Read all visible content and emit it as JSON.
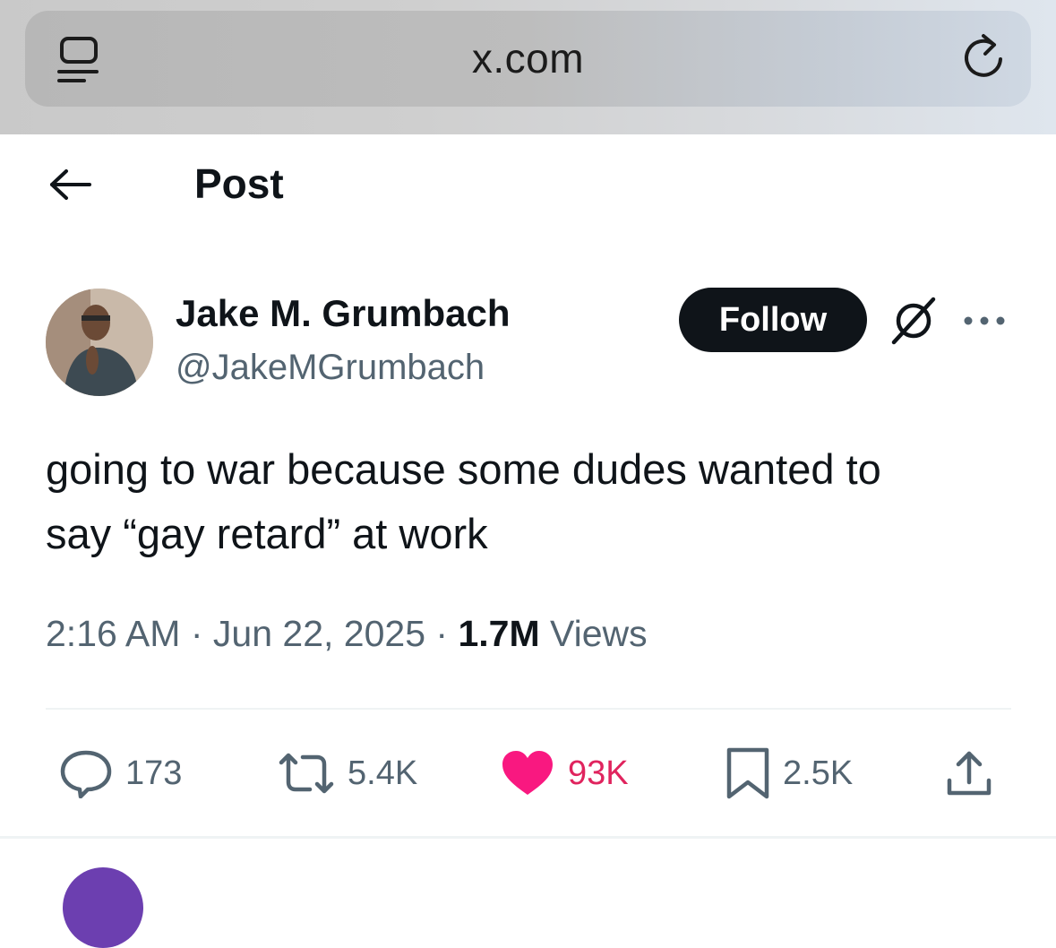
{
  "browser": {
    "url": "x.com",
    "reader_icon": "reader-mode-icon",
    "reload_icon": "reload-icon"
  },
  "header": {
    "title": "Post",
    "back_icon": "back-arrow-icon"
  },
  "author": {
    "name": "Jake M. Grumbach",
    "handle": "@JakeMGrumbach",
    "follow_label": "Follow",
    "grok_icon": "grok-icon",
    "more_icon": "more-icon"
  },
  "tweet": {
    "lines": [
      "going to war because some dudes wanted to",
      "say “gay retard” at work"
    ],
    "time": "2:16 AM",
    "date": "Jun 22, 2025",
    "separator": "·",
    "views_count": "1.7M",
    "views_label": "Views"
  },
  "actions": {
    "replies": "173",
    "reposts": "5.4K",
    "likes": "93K",
    "bookmarks": "2.5K",
    "share_icon": "share-icon"
  },
  "colors": {
    "text": "#0f1419",
    "secondary": "#536471",
    "like": "#f91880",
    "like_count": "#e0245e",
    "follow_bg": "#0f1419"
  }
}
